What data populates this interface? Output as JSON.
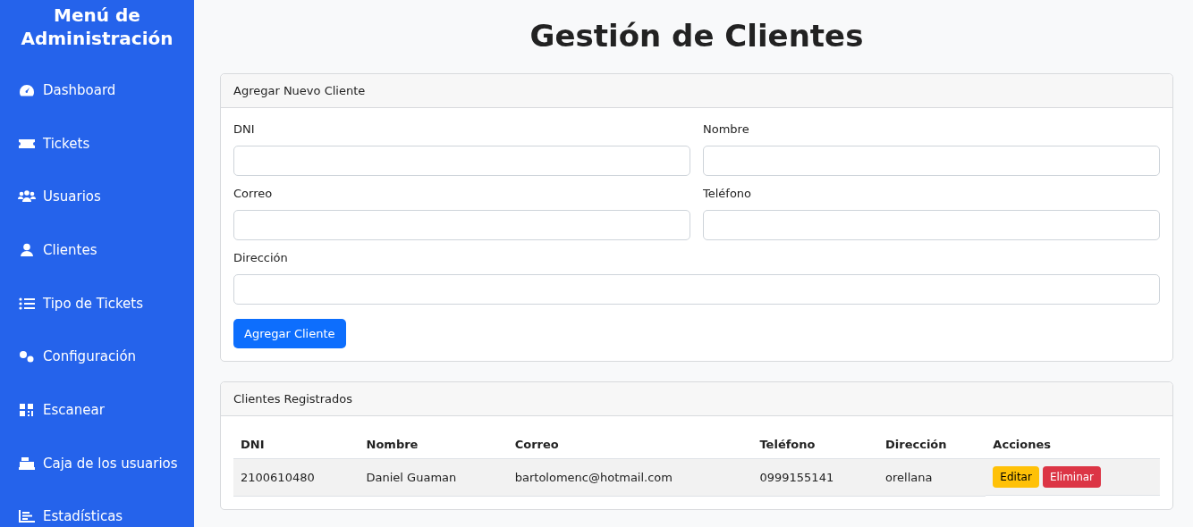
{
  "sidebar": {
    "title": "Menú de Administración",
    "items": [
      {
        "label": "Dashboard"
      },
      {
        "label": "Tickets"
      },
      {
        "label": "Usuarios"
      },
      {
        "label": "Clientes"
      },
      {
        "label": "Tipo de Tickets"
      },
      {
        "label": "Configuración"
      },
      {
        "label": "Escanear"
      },
      {
        "label": "Caja de los usuarios"
      },
      {
        "label": "Estadísticas"
      }
    ]
  },
  "page_title": "Gestión de Clientes",
  "form_card": {
    "header": "Agregar Nuevo Cliente",
    "fields": [
      {
        "label": "DNI",
        "kind": "half"
      },
      {
        "label": "Nombre",
        "kind": "half"
      },
      {
        "label": "Correo",
        "kind": "half"
      },
      {
        "label": "Teléfono",
        "kind": "half"
      },
      {
        "label": "Dirección",
        "kind": "full"
      }
    ],
    "submit": "Agregar Cliente"
  },
  "table_card": {
    "header": "Clientes Registrados",
    "columns": [
      "DNI",
      "Nombre",
      "Correo",
      "Teléfono",
      "Dirección",
      "Acciones"
    ],
    "rows": [
      {
        "cells": [
          "2100610480",
          "Daniel Guaman",
          "bartolomenc@hotmail.com",
          "0999155141",
          "orellana"
        ],
        "actions": [
          {
            "label": "Editar",
            "kind": "edit"
          },
          {
            "label": "Eliminar",
            "kind": "delete"
          }
        ]
      }
    ]
  }
}
